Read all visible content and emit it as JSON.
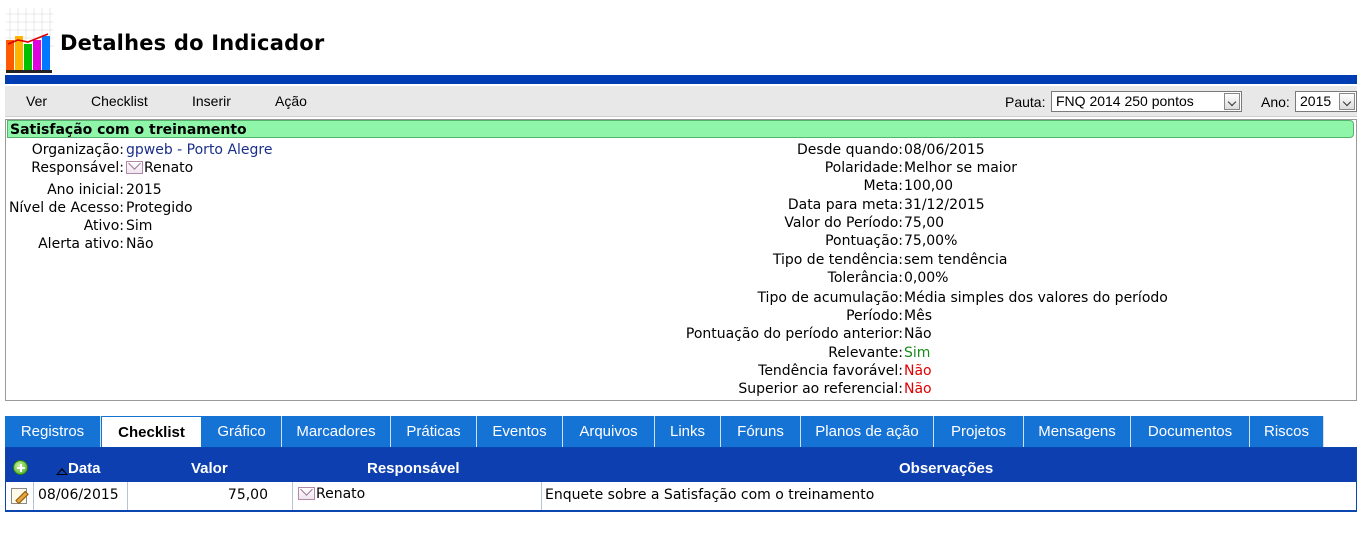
{
  "header": {
    "title": "Detalhes do Indicador"
  },
  "menu": {
    "items": [
      "Ver",
      "Checklist",
      "Inserir",
      "Ação"
    ],
    "pauta_label": "Pauta:",
    "pauta_value": "FNQ 2014 250 pontos",
    "ano_label": "Ano:",
    "ano_value": "2015"
  },
  "indicator": {
    "name": "Satisfação com o treinamento",
    "left": [
      {
        "label": "Organização:",
        "value": "gpweb - Porto Alegre"
      },
      {
        "label": "Responsável:",
        "value": "Renato"
      },
      {
        "label": "Ano inicial:",
        "value": "2015"
      },
      {
        "label": "Nível de Acesso:",
        "value": "Protegido"
      },
      {
        "label": "Ativo:",
        "value": "Sim"
      },
      {
        "label": "Alerta ativo:",
        "value": "Não"
      }
    ],
    "right": [
      {
        "label": "Desde quando:",
        "value": "08/06/2015"
      },
      {
        "label": "Polaridade:",
        "value": "Melhor se maior"
      },
      {
        "label": "Meta:",
        "value": "100,00"
      },
      {
        "label": "Data para meta:",
        "value": "31/12/2015"
      },
      {
        "label": "Valor do Período:",
        "value": "75,00"
      },
      {
        "label": "Pontuação:",
        "value": "75,00%"
      },
      {
        "label": "Tipo de tendência:",
        "value": "sem tendência"
      },
      {
        "label": "Tolerância:",
        "value": "0,00%"
      },
      {
        "label": "Tipo de acumulação:",
        "value": "Média simples dos valores do período"
      },
      {
        "label": "Período:",
        "value": "Mês"
      },
      {
        "label": "Pontuação do período anterior:",
        "value": "Não"
      },
      {
        "label": "Relevante:",
        "value": "Sim"
      },
      {
        "label": "Tendência favorável:",
        "value": "Não"
      },
      {
        "label": "Superior ao referencial:",
        "value": "Não"
      }
    ]
  },
  "colors": {
    "relevante": "#1a8a1a",
    "negative": "#e00000",
    "accent": "#0d3fb0",
    "tab": "#1673d6",
    "indicator_bg": "#8ff5a9"
  },
  "tabs": [
    "Registros",
    "Checklist",
    "Gráfico",
    "Marcadores",
    "Práticas",
    "Eventos",
    "Arquivos",
    "Links",
    "Fóruns",
    "Planos de ação",
    "Projetos",
    "Mensagens",
    "Documentos",
    "Riscos"
  ],
  "active_tab": "Checklist",
  "table": {
    "columns": [
      "Data",
      "Valor",
      "Responsável",
      "Observações"
    ],
    "rows": [
      {
        "data": "08/06/2015",
        "valor": "75,00",
        "responsavel": "Renato",
        "observacoes": "Enquete sobre a Satisfação com o treinamento"
      }
    ]
  },
  "icons": {
    "logo": "bar-chart-logo",
    "add": "add-icon",
    "edit": "edit-icon",
    "mail": "mail-icon",
    "sort": "sort-asc-icon"
  }
}
